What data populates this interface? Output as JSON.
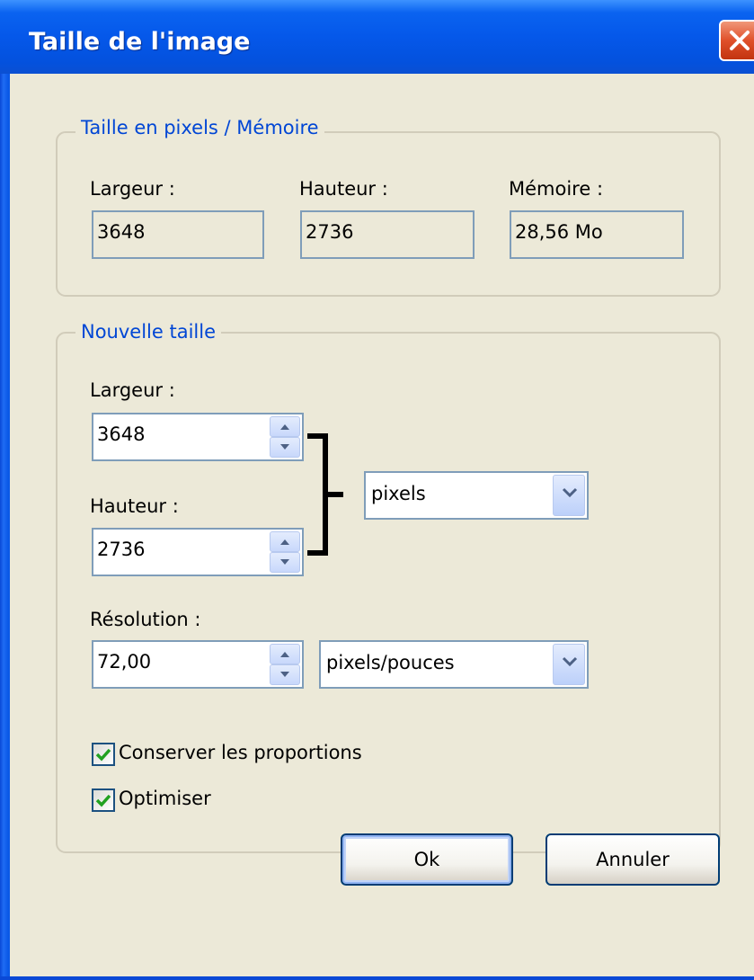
{
  "window": {
    "title": "Taille de l'image"
  },
  "pixel_size_group": {
    "legend": "Taille en pixels / Mémoire",
    "width_label": "Largeur :",
    "width_value": "3648",
    "height_label": "Hauteur :",
    "height_value": "2736",
    "memory_label": "Mémoire :",
    "memory_value": "28,56 Mo"
  },
  "new_size_group": {
    "legend": "Nouvelle taille",
    "width_label": "Largeur :",
    "width_value": "3648",
    "height_label": "Hauteur :",
    "height_value": "2736",
    "unit_selected": "pixels",
    "resolution_label": "Résolution :",
    "resolution_value": "72,00",
    "resolution_unit_selected": "pixels/pouces",
    "keep_proportions_label": "Conserver les proportions",
    "keep_proportions_checked": true,
    "optimize_label": "Optimiser",
    "optimize_checked": true
  },
  "buttons": {
    "ok_label": "Ok",
    "cancel_label": "Annuler"
  },
  "icons": {
    "close": "close-icon",
    "spin_up": "spin-up-icon",
    "spin_down": "spin-down-icon",
    "dropdown": "chevron-down-icon",
    "check": "checkmark-icon",
    "link_bracket": "link-bracket-icon"
  },
  "colors": {
    "title_bar": "#0558ea",
    "client_bg": "#ece9d8",
    "group_legend": "#0046d5",
    "field_border": "#7f9db9",
    "checkmark": "#21a121",
    "close_button": "#e0502a"
  }
}
